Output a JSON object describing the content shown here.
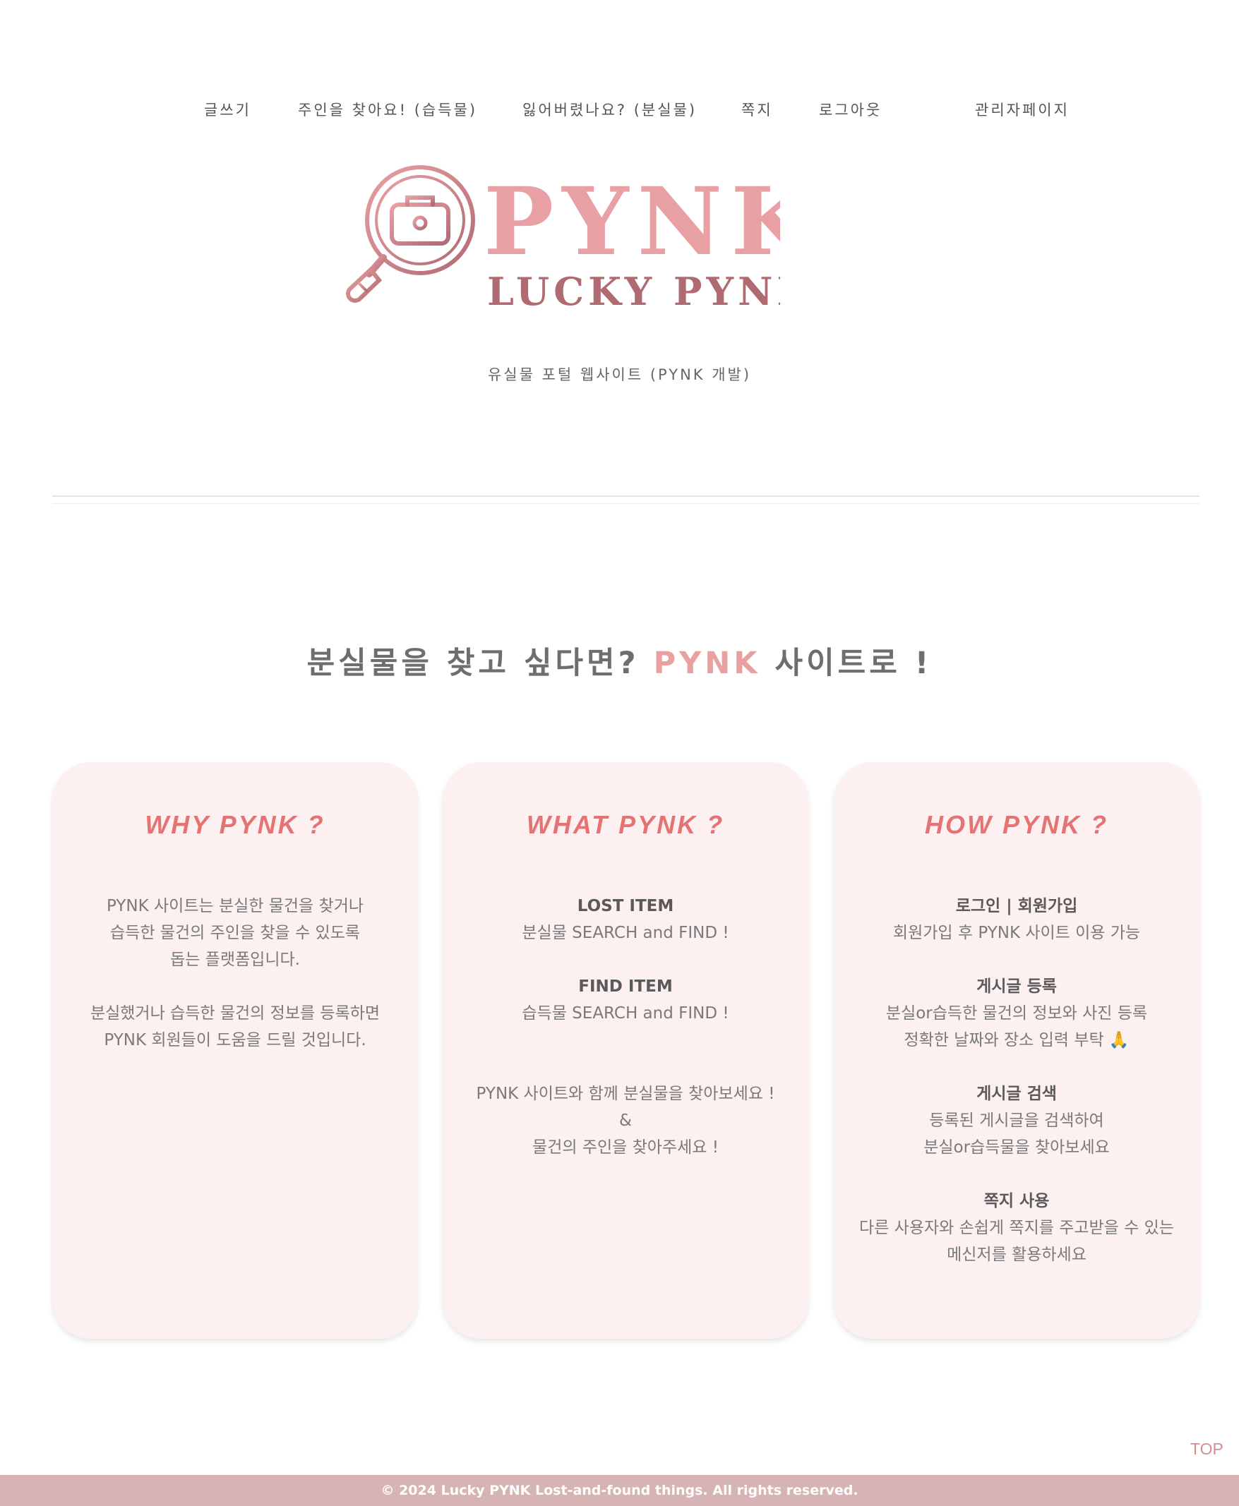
{
  "nav": {
    "items": [
      {
        "label": "글쓰기"
      },
      {
        "label": "주인을 찾아요! (습득물)"
      },
      {
        "label": "잃어버렸나요? (분실물)"
      },
      {
        "label": "쪽지"
      },
      {
        "label": "로그아웃"
      },
      {
        "label": "관리자페이지"
      }
    ]
  },
  "logo": {
    "brand": "PYNK",
    "tagline": "LUCKY PYNK",
    "icon": "magnifier-toolbox-icon",
    "colors": {
      "light": "#e8a0a4",
      "dark": "#b06a72"
    }
  },
  "subtitle": "유실물 포털 웹사이트 (PYNK 개발)",
  "headline": {
    "prefix": "분실물을 찾고 싶다면?",
    "accent": "PYNK",
    "suffix": "사이트로 !",
    "accent_color": "#e8a0a0"
  },
  "cards": [
    {
      "title": "WHY PYNK ?",
      "lines": [
        "PYNK 사이트는 분실한 물건을 찾거나",
        "습득한 물건의 주인을 찾을 수 있도록",
        "돕는 플랫폼입니다.",
        "분실했거나 습득한 물건의 정보를 등록하면",
        "PYNK 회원들이 도움을 드릴 것입니다."
      ]
    },
    {
      "title": "WHAT PYNK ?",
      "sections": [
        {
          "heading": "LOST ITEM",
          "text": "분실물 SEARCH and FIND !"
        },
        {
          "heading": "FIND ITEM",
          "text": "습득물 SEARCH and FIND !"
        }
      ],
      "closing": [
        "PYNK 사이트와 함께 분실물을 찾아보세요 !",
        "&",
        "물건의 주인을 찾아주세요 !"
      ]
    },
    {
      "title": "HOW PYNK ?",
      "sections": [
        {
          "heading": "로그인 | 회원가입",
          "lines": [
            "회원가입 후 PYNK 사이트 이용 가능"
          ]
        },
        {
          "heading": "게시글 등록",
          "lines": [
            "분실or습득한 물건의 정보와 사진 등록",
            "정확한 날짜와 장소 입력 부탁 🙏"
          ]
        },
        {
          "heading": "게시글 검색",
          "lines": [
            "등록된 게시글을 검색하여",
            "분실or습득물을 찾아보세요"
          ]
        },
        {
          "heading": "쪽지 사용",
          "lines": [
            "다른 사용자와 손쉽게 쪽지를 주고받을 수 있는",
            "메신저를 활용하세요"
          ]
        }
      ]
    }
  ],
  "top_link": "TOP",
  "footer": "© 2024 Lucky PYNK Lost-and-found things. All rights reserved.",
  "colors": {
    "card_bg": "#fdf0f0",
    "card_title": "#e57373",
    "footer_bg": "#d6b3b5"
  }
}
